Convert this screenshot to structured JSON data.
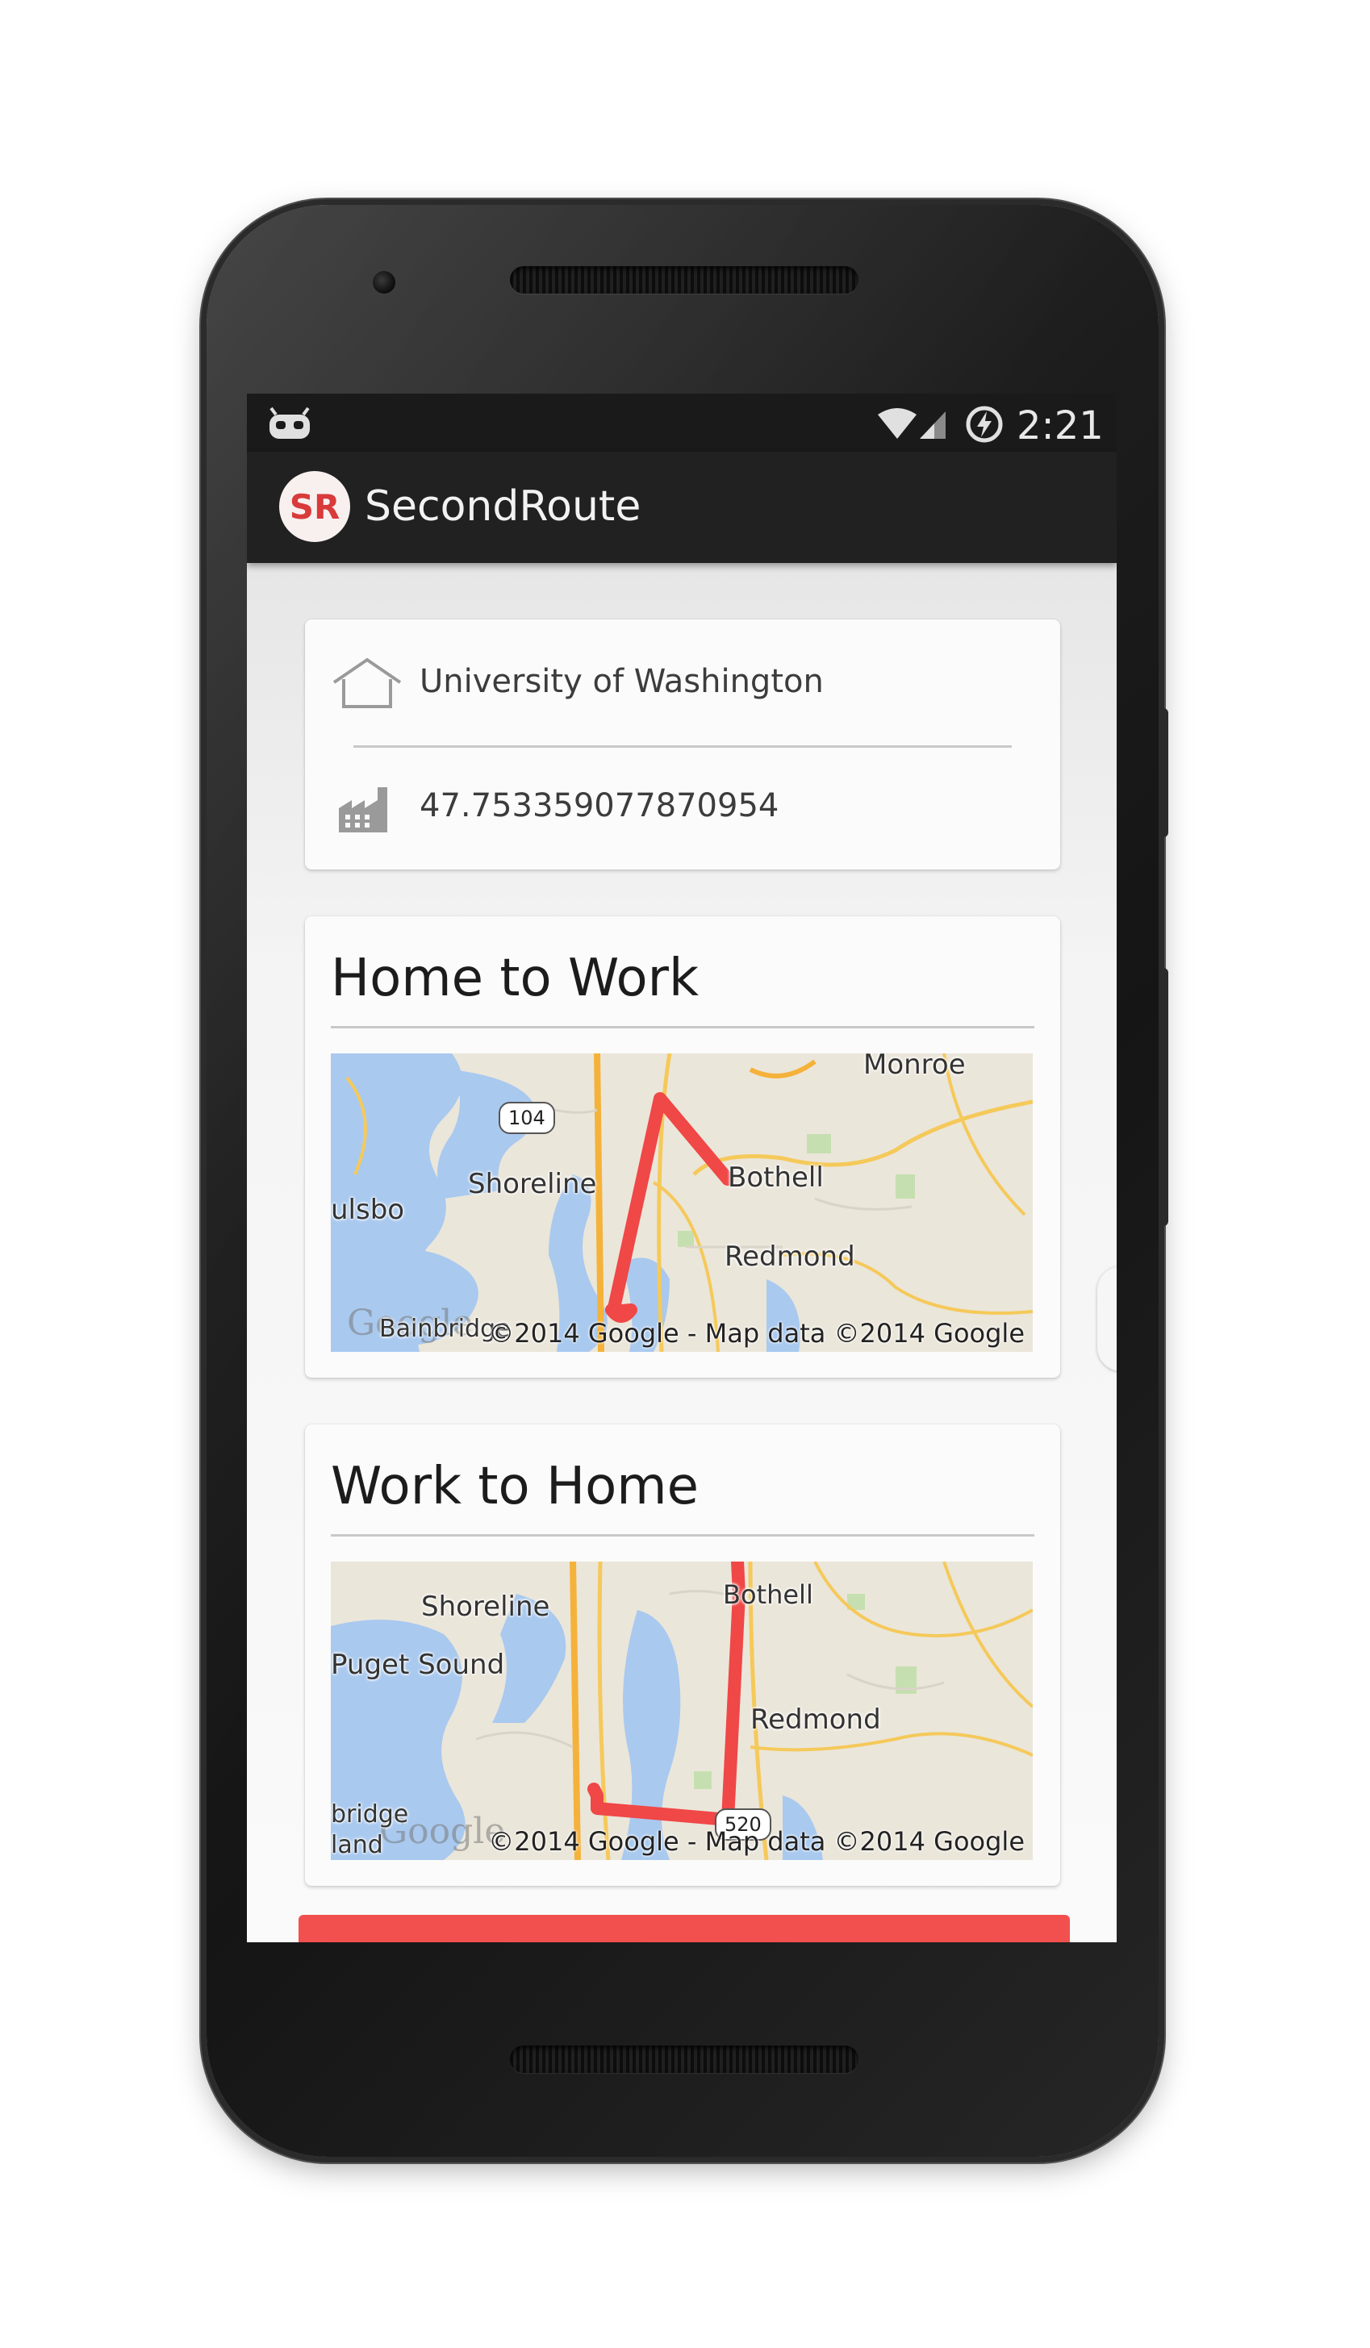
{
  "status_bar": {
    "time": "2:21",
    "icons": [
      "android-icon",
      "wifi-icon",
      "signal-icon",
      "battery-icon"
    ]
  },
  "app_bar": {
    "logo_text": "SR",
    "title": "SecondRoute"
  },
  "location_card": {
    "home_label": "University of Washington",
    "work_label": "47.753359077870954",
    "home_icon": "home-icon",
    "work_icon": "factory-icon"
  },
  "routes": [
    {
      "title": "Home to Work",
      "map_labels": [
        "Monroe",
        "Shoreline",
        "ulsbo",
        "Bothell",
        "Redmond",
        "Bainbridge"
      ],
      "highway_shields": [
        "104"
      ],
      "watermark": "Google",
      "copyright": "©2014 Google - Map data ©2014 Google"
    },
    {
      "title": "Work to Home",
      "map_labels": [
        "Shoreline",
        "Puget Sound",
        "Bothell",
        "Redmond",
        "bridge",
        "land"
      ],
      "highway_shields": [
        "520"
      ],
      "watermark": "Google",
      "copyright": "©2014 Google - Map data ©2014 Google"
    }
  ],
  "colors": {
    "accent": "#f2504e",
    "route_line": "#f04747",
    "app_bar": "#212121",
    "status_bar": "#1a1a1a"
  }
}
